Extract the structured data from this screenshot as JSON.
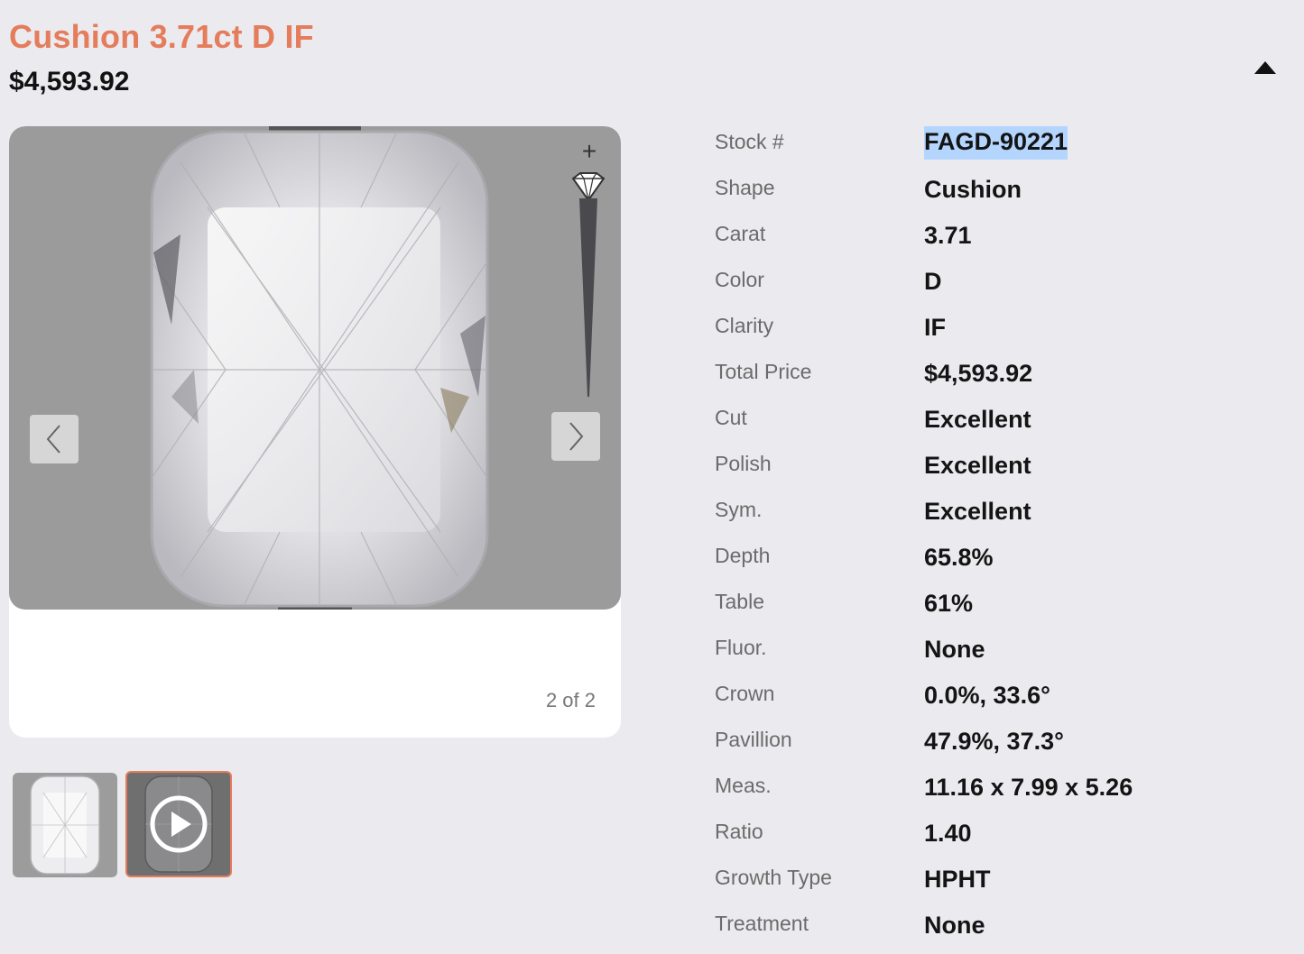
{
  "header": {
    "title": "Cushion 3.71ct D IF",
    "price": "$4,593.92"
  },
  "viewer": {
    "zoom_in_label": "+",
    "counter": "2 of 2"
  },
  "specs": [
    {
      "label": "Stock #",
      "value": "FAGD-90221",
      "selected": true
    },
    {
      "label": "Shape",
      "value": "Cushion"
    },
    {
      "label": "Carat",
      "value": "3.71"
    },
    {
      "label": "Color",
      "value": "D"
    },
    {
      "label": "Clarity",
      "value": "IF"
    },
    {
      "label": "Total Price",
      "value": "$4,593.92"
    },
    {
      "label": "Cut",
      "value": "Excellent"
    },
    {
      "label": "Polish",
      "value": "Excellent"
    },
    {
      "label": "Sym.",
      "value": "Excellent"
    },
    {
      "label": "Depth",
      "value": "65.8%"
    },
    {
      "label": "Table",
      "value": "61%"
    },
    {
      "label": "Fluor.",
      "value": "None"
    },
    {
      "label": "Crown",
      "value": "0.0%, 33.6°"
    },
    {
      "label": "Pavillion",
      "value": "47.9%, 37.3°"
    },
    {
      "label": "Meas.",
      "value": "11.16 x 7.99 x 5.26"
    },
    {
      "label": "Ratio",
      "value": "1.40"
    },
    {
      "label": "Growth Type",
      "value": "HPHT"
    },
    {
      "label": "Treatment",
      "value": "None"
    }
  ],
  "colors": {
    "accent": "#e57c5b",
    "background": "#ebebef",
    "selection": "#b4d5fe"
  },
  "icons": {
    "collapse": "triangle-up-icon",
    "zoom_in": "plus-icon",
    "zoom_scale": "diamond-icon",
    "zoom_out": "minus-icon",
    "prev": "chevron-left-icon",
    "next": "chevron-right-icon",
    "play": "play-icon"
  }
}
